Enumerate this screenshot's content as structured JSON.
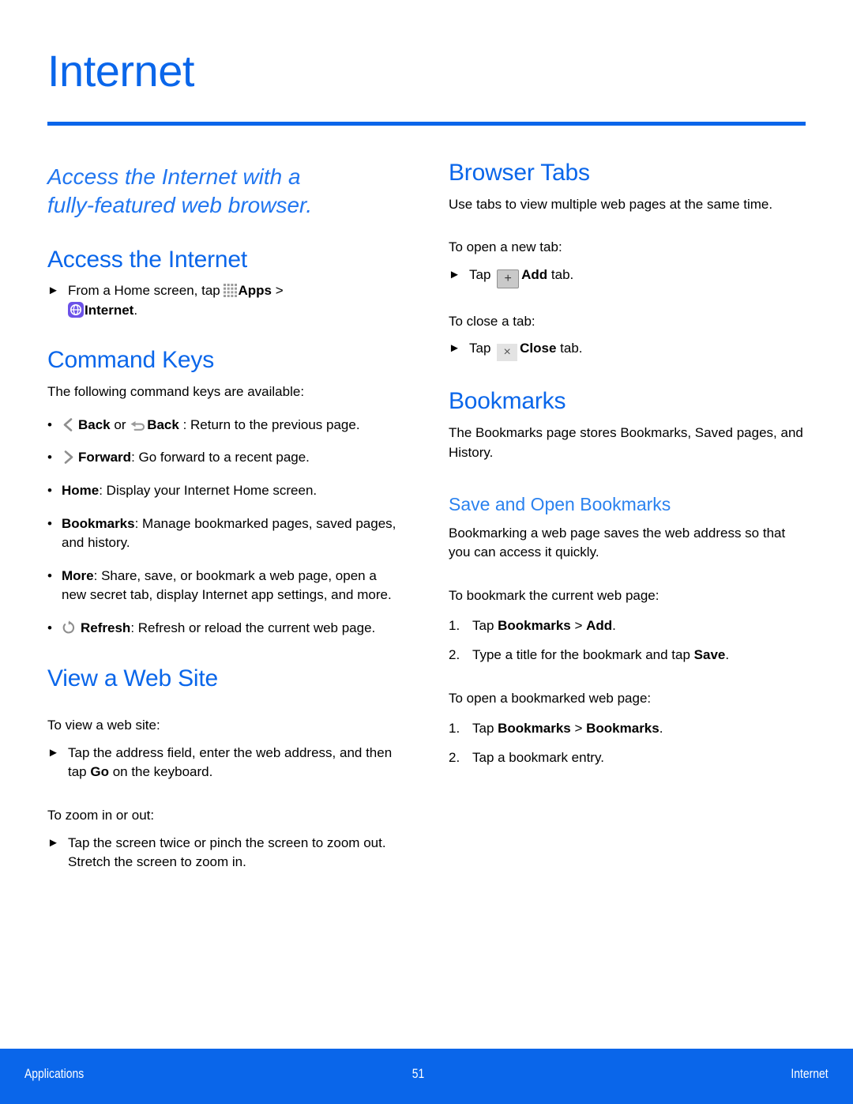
{
  "page": {
    "title": "Internet",
    "accent_color": "#0a66ea",
    "subheading_color": "#2b82ef"
  },
  "lead": {
    "line1": "Access the Internet with a",
    "line2": "fully-featured web browser."
  },
  "left_column": {
    "access": {
      "heading": "Access the Internet",
      "step_prefix": "From a Home screen, tap ",
      "apps_label": "Apps",
      "separator": " > ",
      "internet_label": "Internet",
      "period": "."
    },
    "command_keys": {
      "heading": "Command Keys",
      "intro": "The following command keys are available:",
      "items": [
        {
          "icon": "chevron-left-icon",
          "label": "Back",
          "middle": " or ",
          "icon2": "back-arrow-icon",
          "label2": "Back",
          "description": " : Return to the previous page."
        },
        {
          "icon": "chevron-right-icon",
          "label": "Forward",
          "description": ": Go forward to a recent page."
        },
        {
          "icon": "",
          "label": "Home",
          "description": ": Display your Internet Home screen."
        },
        {
          "icon": "",
          "label": "Bookmarks",
          "description": ": Manage bookmarked pages, saved pages, and history."
        },
        {
          "icon": "",
          "label": "More",
          "description": ": Share, save, or bookmark a web page, open a new secret tab, display Internet app settings, and more."
        },
        {
          "icon": "refresh-icon",
          "label": "Refresh",
          "description": ": Refresh or reload the current web page."
        }
      ]
    },
    "view_web_site": {
      "heading": "View a Web Site",
      "intro1": "To view a web site:",
      "step1_pre": "Tap the address field, enter the web address, and then tap ",
      "step1_bold": "Go",
      "step1_post": " on the keyboard.",
      "intro2": "To zoom in or out:",
      "step2": "Tap the screen twice or pinch the screen to zoom out. Stretch the screen to zoom in."
    }
  },
  "right_column": {
    "browser_tabs": {
      "heading": "Browser Tabs",
      "intro": "Use tabs to view multiple web pages at the same time.",
      "open_label": "To open a new tab:",
      "open_step_pre": "Tap ",
      "open_key": "+",
      "open_step_bold": "Add",
      "open_step_post": " tab.",
      "close_label": "To close a tab:",
      "close_step_pre": "Tap ",
      "close_key": "×",
      "close_step_bold": "Close",
      "close_step_post": " tab."
    },
    "bookmarks": {
      "heading": "Bookmarks",
      "intro": "The Bookmarks page stores Bookmarks, Saved pages, and History.",
      "subheading": "Save and Open Bookmarks",
      "sub_intro": "Bookmarking a web page saves the web address so that you can access it quickly.",
      "task1_label": "To bookmark the current web page:",
      "task1_steps": [
        {
          "num": "1.",
          "pre": "Tap ",
          "bold1": "Bookmarks",
          "mid": " > ",
          "bold2": "Add",
          "post": "."
        },
        {
          "num": "2.",
          "pre": "Type a title for the bookmark and tap ",
          "bold1": "Save",
          "mid": "",
          "bold2": "",
          "post": "."
        }
      ],
      "task2_label": "To open a bookmarked web page:",
      "task2_steps": [
        {
          "num": "1.",
          "pre": "Tap ",
          "bold1": "Bookmarks",
          "mid": " > ",
          "bold2": "Bookmarks",
          "post": "."
        },
        {
          "num": "2.",
          "pre": "Tap a bookmark entry.",
          "bold1": "",
          "mid": "",
          "bold2": "",
          "post": ""
        }
      ]
    }
  },
  "footer": {
    "left": "Applications",
    "center": "51",
    "right": "Internet"
  }
}
